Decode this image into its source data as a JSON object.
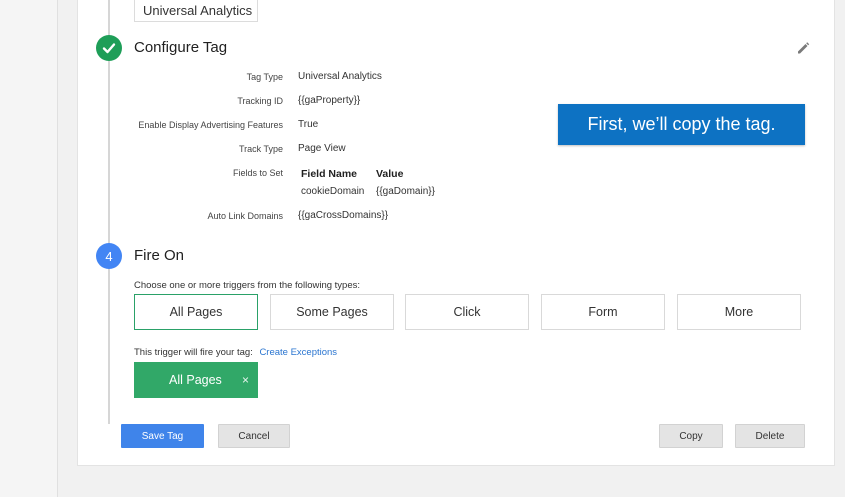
{
  "previous_step": {
    "value": "Universal Analytics"
  },
  "configure": {
    "title": "Configure Tag",
    "rows": [
      {
        "label": "Tag Type",
        "value": "Universal Analytics"
      },
      {
        "label": "Tracking ID",
        "value": "{{gaProperty}}"
      },
      {
        "label": "Enable Display Advertising Features",
        "value": "True"
      },
      {
        "label": "Track Type",
        "value": "Page View"
      },
      {
        "label": "Fields to Set",
        "value": ""
      },
      {
        "label": "Auto Link Domains",
        "value": "{{gaCrossDomains}}"
      }
    ],
    "fields_to_set": {
      "headers": [
        "Field Name",
        "Value"
      ],
      "rows": [
        [
          "cookieDomain",
          "{{gaDomain}}"
        ]
      ]
    }
  },
  "callout": {
    "text": "First, we’ll copy the tag."
  },
  "fire_on": {
    "step_number": "4",
    "title": "Fire On",
    "choose_text": "Choose one or more triggers from the following types:",
    "triggers": [
      "All Pages",
      "Some Pages",
      "Click",
      "Form",
      "More"
    ],
    "will_fire_text": "This trigger will fire your tag:",
    "create_exceptions": "Create Exceptions",
    "selected_chip": "All Pages",
    "chip_remove": "×"
  },
  "actions": {
    "save": "Save Tag",
    "cancel": "Cancel",
    "copy": "Copy",
    "delete": "Delete"
  },
  "colors": {
    "complete_green": "#1e9e58",
    "step_blue": "#4285f4",
    "callout_blue": "#0d72c3",
    "chip_green": "#31a868",
    "save_blue": "#3f84ea"
  }
}
